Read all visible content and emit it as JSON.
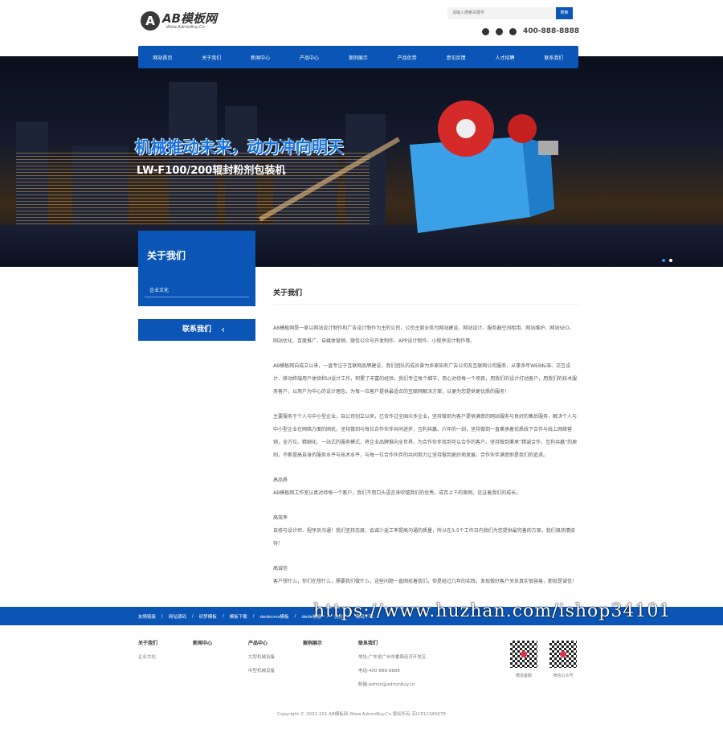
{
  "header": {
    "logo_text": "AB模板网",
    "logo_sub": "Www.AdminBuy.Cn",
    "search_placeholder": "请输入搜索关键字",
    "search_button": "搜索",
    "phone": "400-888-8888"
  },
  "nav": [
    "网站首页",
    "关于我们",
    "新闻中心",
    "产品中心",
    "案例展示",
    "产品优势",
    "意见反馈",
    "人才招聘",
    "联系我们"
  ],
  "hero": {
    "title": "机械推动未来，动力冲向明天",
    "subtitle": "LW-F100/200辊封粉剂包装机"
  },
  "sidebar": {
    "title": "关于我们",
    "items": [
      "企业文化"
    ],
    "contact_button": "联系我们"
  },
  "main": {
    "title": "关于我们",
    "paragraphs": [
      "AB模板网是一家以网站设计制作和广告设计制作为主的公司，公司主营业务为网站建设、网站设计、服务器空间租用、网站维护、网站SEO、网站优化、百度推广、自媒体营销、微信公众号开发制作、APP设计制作、小程序设计制作等。",
      "AB模板网自成立以来，一直专注于互联网品牌建设，我们团队的成员曾为多家知名广告公司及互联网公司服务，从事多年WEB标准、交互设计、移动终端用户体验和UI设计工作，积累了丰富的经验。我们专注每个细节，用心对待每一个项目，用我们的设计打动客户，用我们的技术服务客户，以用户为中心的设计理念，为每一位客户提供最适合的互联网解决方案，以便为您提供更优质的服务！",
      "主要服务于个人与中小型企业，自公司创立以来，已合作过全国众多企业，坚持做到为客户提供满意的网站服务与良好的售后服务，解决个人与中小型企业在网络方面的困扰，坚持做到与每位合作伙伴共同进步，互利共赢。六年的一刻，坚持做到一直秉承着优质线下合作与线上网络营销，全方位、精细化、一站式的服务模式，将企业品牌推向全世界，为合作伙伴找到可以合作的客户。坚持做到秉承“精诚合作，互利共赢”的原则，不断提高自身的服务水平与技术水平，与每一位合作伙伴的共同努力让坚持做到更好地发展，合作伙伴满意即是我们的追求。"
    ],
    "sections": [
      {
        "title": "高品质",
        "text": "AB模板网工作室认真对待每一个客户，我们不用口头语言来吹嘘我们的优秀，成百上千的案例，见证着我们的成长。"
      },
      {
        "title": "高效率",
        "text": "自修与设计师、程序员沟通！我们坚持态度，会减少返工率提高沟通的质量，所以在3-5个工作日内我们为您提供最完善的方案，我们很热情接待！"
      },
      {
        "title": "高诚信",
        "text": "客户想什么，你们在想什么，需要我们做什么，这些问题一直困扰着我们。但是经过几年的实践，发现做好客户关系真实很容易，那就是诚信！"
      }
    ]
  },
  "footer_links": {
    "label": "友情链接",
    "items": [
      "网站源码",
      "织梦模板",
      "模板下载",
      "dedecms模板",
      "dede模板",
      "优化",
      "源码下载"
    ]
  },
  "footer": {
    "columns": [
      {
        "title": "关于我们",
        "items": [
          "企业文化"
        ]
      },
      {
        "title": "新闻中心",
        "items": []
      },
      {
        "title": "产品中心",
        "items": [
          "大型机械设备",
          "中型机械设备"
        ]
      },
      {
        "title": "案例展示",
        "items": []
      },
      {
        "title": "联系我们",
        "items": [
          "地址:广东省广州市番禺经济开发区",
          "电话:400-888-8888",
          "邮箱:admin@adminbuy.cn"
        ]
      }
    ],
    "qr": [
      "微信客服",
      "微信公众号"
    ],
    "copyright": "Copyright © 2002-201 AB模板网 Www.AdminBuy.Cn 版权所有    苏ICP12345678"
  },
  "watermark": "https://www.huzhan.com/ishop34101",
  "colors": {
    "brand": "#0a55b5"
  }
}
